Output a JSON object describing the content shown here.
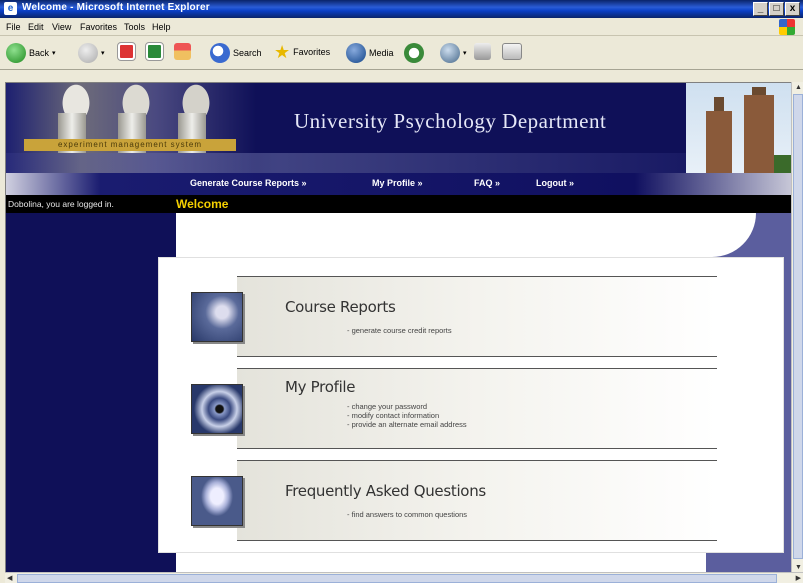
{
  "window": {
    "title": "Welcome - Microsoft Internet Explorer",
    "controls": [
      "_",
      "□",
      "x"
    ]
  },
  "menu": [
    "File",
    "Edit",
    "View",
    "Favorites",
    "Tools",
    "Help"
  ],
  "toolbar": {
    "back": "Back",
    "search": "Search",
    "favorites": "Favorites",
    "media": "Media"
  },
  "header": {
    "ems": "experiment management system",
    "dept": "University Psychology Department"
  },
  "nav": [
    "Generate Course Reports »",
    "My Profile »",
    "FAQ »",
    "Logout »"
  ],
  "login": {
    "user": "Dobolina, you are logged in.",
    "welcome": "Welcome"
  },
  "sections": [
    {
      "title": "Course Reports",
      "items": [
        "- generate course credit reports"
      ]
    },
    {
      "title": "My Profile",
      "items": [
        "- change your password",
        "- modify contact information",
        "- provide an alternate email address"
      ]
    },
    {
      "title": "Frequently Asked Questions",
      "items": [
        "- find answers to common questions"
      ]
    }
  ]
}
